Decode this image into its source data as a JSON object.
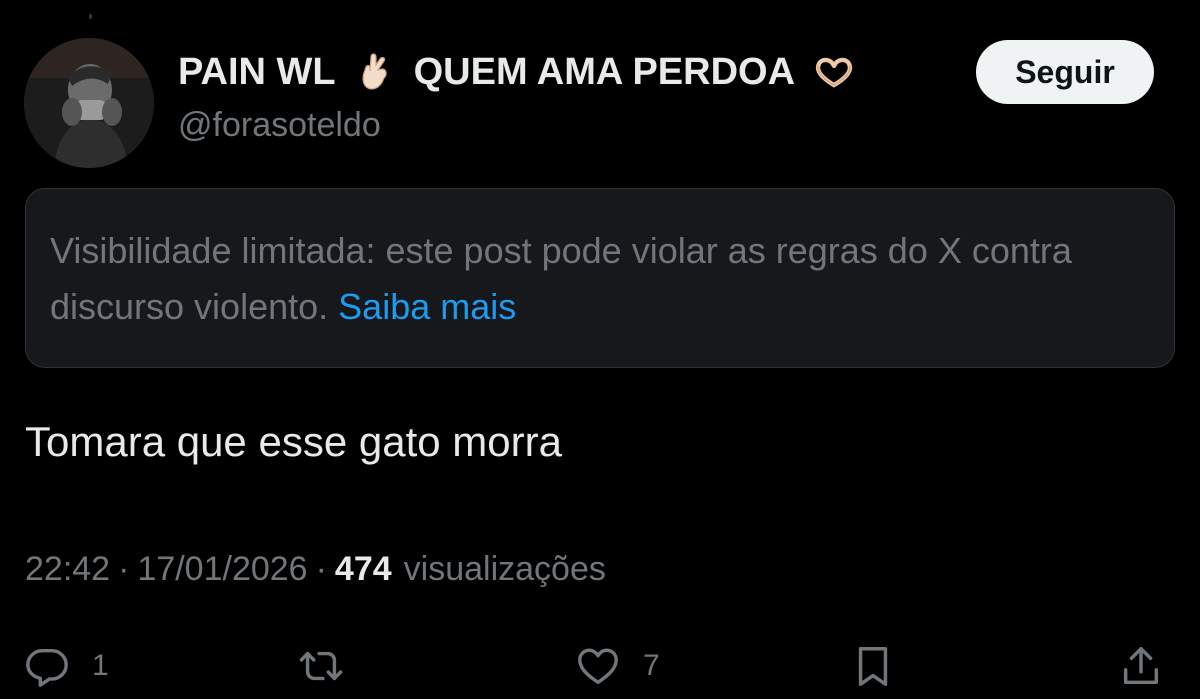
{
  "author": {
    "display_name_part1": "PAIN WL",
    "display_name_part2": "QUEM AMA PERDOA",
    "emoji_1": "crossed-fingers-icon",
    "emoji_2": "heart-hands-icon",
    "handle": "@forasoteldo"
  },
  "follow_button_label": "Seguir",
  "notice": {
    "text": "Visibilidade limitada: este post pode violar as regras do X contra discurso violento.",
    "link_text": "Saiba mais"
  },
  "tweet": {
    "text": "Tomara que esse gato morra",
    "time": "22:42",
    "date": "17/01/2026",
    "separator": "·",
    "views_count": "474",
    "views_label": "visualizações"
  },
  "actions": {
    "reply_count": "1",
    "retweet_count": "",
    "like_count": "7",
    "icons": [
      "reply-icon",
      "retweet-icon",
      "like-icon",
      "bookmark-icon",
      "share-icon"
    ]
  },
  "colors": {
    "background": "#000000",
    "primary_text": "#e7e9ea",
    "secondary_text": "#71767b",
    "link": "#1d9bf0",
    "notice_background": "#16181c",
    "button_background": "#eff3f4"
  }
}
